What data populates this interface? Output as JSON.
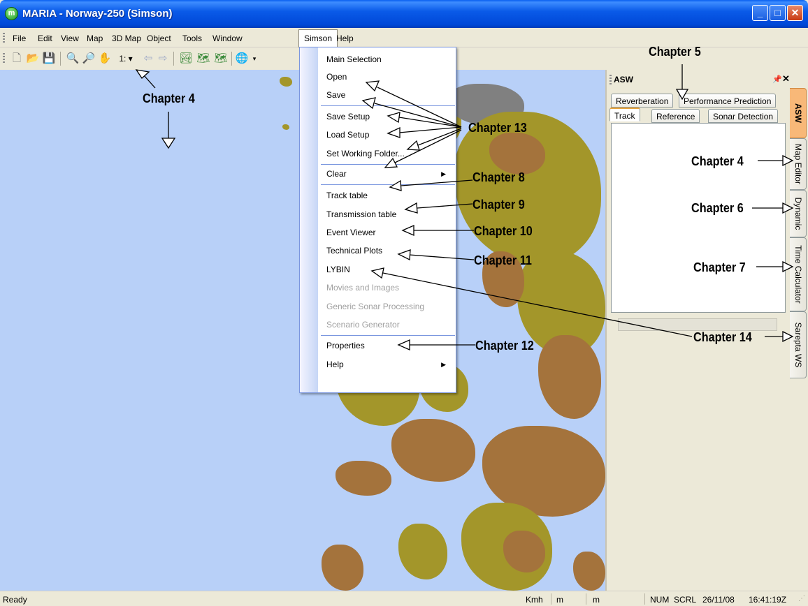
{
  "window": {
    "title": "MARIA - Norway-250 (Simson)",
    "app_icon": "m"
  },
  "menubar": {
    "items": [
      "File",
      "Edit",
      "View",
      "Map",
      "3D Map",
      "Object",
      "Tools",
      "Window",
      "Simson",
      "Help"
    ]
  },
  "toolbar": {
    "scale_label": "1:"
  },
  "simson_menu": {
    "items": [
      {
        "label": "Main Selection",
        "enabled": true
      },
      {
        "label": "Open",
        "enabled": true
      },
      {
        "label": "Save",
        "enabled": true
      },
      {
        "label": "Save Setup",
        "enabled": true
      },
      {
        "label": "Load Setup",
        "enabled": true
      },
      {
        "label": "Set Working Folder...",
        "enabled": true
      },
      {
        "label": "Clear",
        "enabled": true,
        "submenu": true
      },
      {
        "label": "Track table",
        "enabled": true
      },
      {
        "label": "Transmission table",
        "enabled": true
      },
      {
        "label": "Event Viewer",
        "enabled": true
      },
      {
        "label": "Technical Plots",
        "enabled": true
      },
      {
        "label": "LYBIN",
        "enabled": true
      },
      {
        "label": "Movies and Images",
        "enabled": false
      },
      {
        "label": "Generic Sonar Processing",
        "enabled": false
      },
      {
        "label": "Scenario Generator",
        "enabled": false
      },
      {
        "label": "Properties",
        "enabled": true
      },
      {
        "label": "Help",
        "enabled": true,
        "submenu": true
      }
    ]
  },
  "panel": {
    "title": "ASW",
    "tabs_row1": [
      "Reverberation",
      "Performance Prediction"
    ],
    "tabs_row2": [
      "Track",
      "Reference",
      "Sonar Detection"
    ],
    "selected_tab": "Track"
  },
  "side_tabs": [
    "ASW",
    "Map Editor",
    "Dynamic",
    "Time Calculator",
    "Sarepta WS"
  ],
  "statusbar": {
    "ready": "Ready",
    "speed_unit": "Kmh",
    "unit1": "m",
    "unit2": "m",
    "num": "NUM",
    "scrl": "SCRL",
    "date": "26/11/08",
    "time": "16:41:19Z"
  },
  "annotations": {
    "ch4_toolbar": "Chapter 4",
    "ch5": "Chapter 5",
    "ch13": "Chapter 13",
    "ch8": "Chapter 8",
    "ch9": "Chapter 9",
    "ch10": "Chapter 10",
    "ch11": "Chapter 11",
    "ch12": "Chapter 12",
    "ch4_side": "Chapter 4",
    "ch6": "Chapter 6",
    "ch7": "Chapter 7",
    "ch14": "Chapter 14"
  },
  "colors": {
    "sea": "#b8d0f8",
    "land_olive": "#a3962a",
    "land_brown": "#a4733c",
    "menu_border": "#7a96df",
    "selected_tab": "#f8b878"
  }
}
